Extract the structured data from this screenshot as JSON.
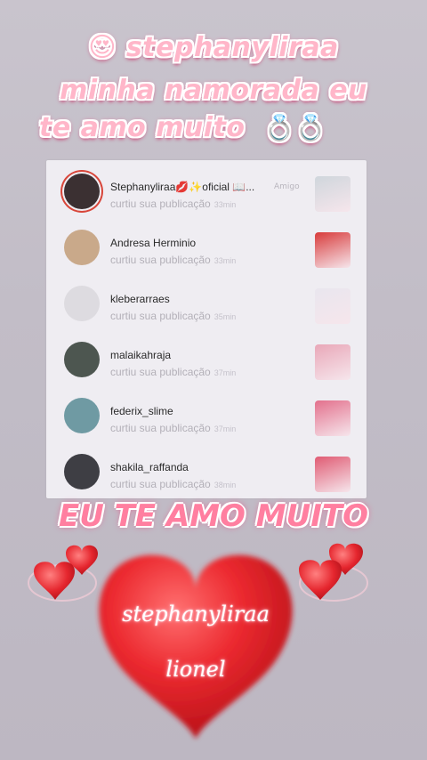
{
  "header": {
    "line1": "stephanyliraa",
    "line2": "minha namorada eu",
    "line3": "te amo muito",
    "line1_emoji": "😍",
    "line3_emoji": "💍💍"
  },
  "notifications": [
    {
      "username": "Stephanyliraa💋✨oficial 📖...",
      "action": "curtiu sua publicação",
      "time": "33min",
      "tag": "Amigo",
      "avatar_color": "#3b3032",
      "thumb_color": "#cfd6dc"
    },
    {
      "username": "Andresa Herminio",
      "action": "curtiu sua publicação",
      "time": "33min",
      "tag": "",
      "avatar_color": "#c9a98a",
      "thumb_color": "#d83b3b"
    },
    {
      "username": "kleberarraes",
      "action": "curtiu sua publicação",
      "time": "35min",
      "tag": "",
      "avatar_color": "#dddbe0",
      "thumb_color": "#e9e6ee"
    },
    {
      "username": "malaikahraja",
      "action": "curtiu sua publicação",
      "time": "37min",
      "tag": "",
      "avatar_color": "#4d5650",
      "thumb_color": "#e9a7b8"
    },
    {
      "username": "federix_slime",
      "action": "curtiu sua publicação",
      "time": "37min",
      "tag": "",
      "avatar_color": "#6f9aa3",
      "thumb_color": "#e3708c"
    },
    {
      "username": "shakila_raffanda",
      "action": "curtiu sua publicação",
      "time": "38min",
      "tag": "",
      "avatar_color": "#3e3e44",
      "thumb_color": "#e05b73"
    }
  ],
  "banner": "EU TE AMO MUITO",
  "heart": {
    "name": "stephanyliraa",
    "name2": "lionel",
    "color": "#e8242c"
  }
}
